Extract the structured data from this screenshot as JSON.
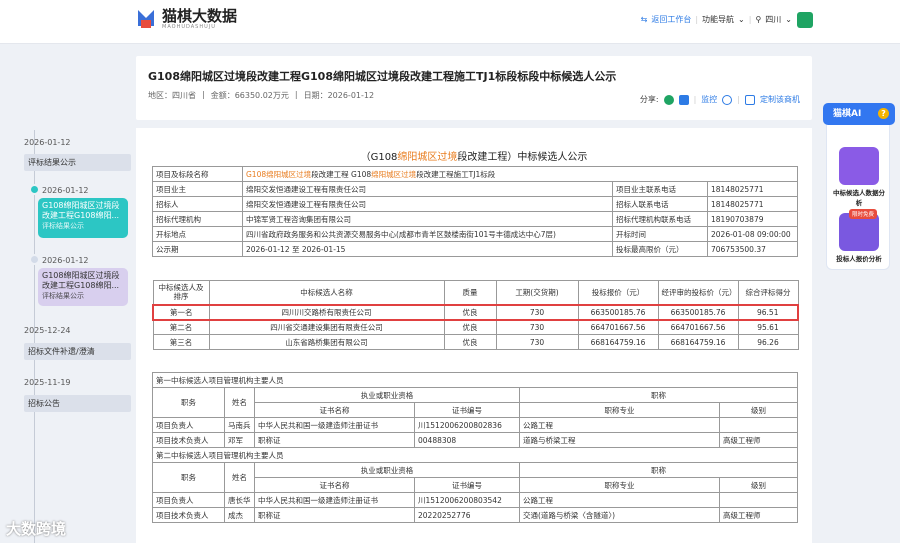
{
  "topbar": {
    "logo_text": "猫棋大数据",
    "logo_sub": "MAOHUDASHUJU",
    "back_label": "返回工作台",
    "nav_label": "功能导航",
    "region": "四川"
  },
  "header": {
    "title": "G108绵阳城区过境段改建工程G108绵阳城区过境段改建工程施工TJ1标段标段中标候选人公示",
    "region": "地区：四川省",
    "amount": "金额：66350.02万元",
    "date": "日期：2026-01-12",
    "share": "分享:",
    "monitor": "监控",
    "subscribe": "定制该商机"
  },
  "timeline": [
    {
      "date": "2026-01-12",
      "label": "评标结果公示"
    },
    {
      "date": "2026-01-12",
      "label": "G108绵阳城区过境段改建工程G108绵阳...",
      "sub": "评标结果公示"
    },
    {
      "date": "2026-01-12",
      "label": "G108绵阳城区过境段改建工程G108绵阳...",
      "sub": "评标结果公示"
    },
    {
      "date": "2025-12-24",
      "label": "招标文件补遗/澄清"
    },
    {
      "date": "2025-11-19",
      "label": "招标公告"
    }
  ],
  "doc": {
    "title_pre": "（G108",
    "title_hl": "绵阳城区过境",
    "title_post": "段改建工程）中标候选人公示"
  },
  "info": {
    "project_name_label": "项目及标段名称",
    "project_name_a": "G108绵阳城区过境",
    "project_name_b": "段改建工程 G108",
    "project_name_c": "绵阳城区过境",
    "project_name_d": "段改建工程施工TJ1标段",
    "rows": [
      [
        "项目业主",
        "绵阳交发恒通建设工程有限责任公司",
        "项目业主联系电话",
        "18148025771"
      ],
      [
        "招标人",
        "绵阳交发恒通建设工程有限责任公司",
        "招标人联系电话",
        "18148025771"
      ],
      [
        "招标代理机构",
        "中锦军贤工程咨询集团有限公司",
        "招标代理机构联系电话",
        "18190703879"
      ],
      [
        "开标地点",
        "四川省政府政务服务和公共资源交易服务中心(成都市青羊区鼓楼南街101号丰德成达中心7层)",
        "开标时间",
        "2026-01-08 09:00:00"
      ],
      [
        "公示期",
        "2026-01-12 至 2026-01-15",
        "投标最高限价（元）",
        "706753500.37"
      ]
    ]
  },
  "candidates": {
    "headers": [
      "中标候选人及排序",
      "中标候选人名称",
      "质量",
      "工期(交货期)",
      "投标报价（元）",
      "经评审的投标价（元）",
      "综合评标得分"
    ],
    "rows": [
      [
        "第一名",
        "四川川交路桥有限责任公司",
        "优良",
        "730",
        "663500185.76",
        "663500185.76",
        "96.51"
      ],
      [
        "第二名",
        "四川省交通建设集团有限责任公司",
        "优良",
        "730",
        "664701667.56",
        "664701667.56",
        "95.61"
      ],
      [
        "第三名",
        "山东省路桥集团有限公司",
        "优良",
        "730",
        "668164759.16",
        "668164759.16",
        "96.26"
      ]
    ]
  },
  "staff": {
    "sec1_title": "第一中标候选人项目管理机构主要人员",
    "sec2_title": "第二中标候选人项目管理机构主要人员",
    "h_duty": "职务",
    "h_name": "姓名",
    "h_qual": "执业或职业资格",
    "h_title": "职称",
    "h_cert": "证书名称",
    "h_certno": "证书编号",
    "h_major": "职称专业",
    "h_level": "级别",
    "sec1": [
      [
        "项目负责人",
        "马南兵",
        "中华人民共和国一级建造师注册证书",
        "川1512006200802836",
        "公路工程",
        ""
      ],
      [
        "项目技术负责人",
        "邓军",
        "职称证",
        "00488308",
        "道路与桥梁工程",
        "高级工程师"
      ]
    ],
    "sec2": [
      [
        "项目负责人",
        "唐长华",
        "中华人民共和国一级建造师注册证书",
        "川1512006200803542",
        "公路工程",
        ""
      ],
      [
        "项目技术负责人",
        "成杰",
        "职称证",
        "20220252776",
        "交通(道路与桥梁〈含隧道〉)",
        "高级工程师"
      ]
    ]
  },
  "ai": {
    "title": "猫棋AI",
    "q": "?",
    "card1": "中标候选人数据分析",
    "badge": "限时免费",
    "card2": "投标人报价分析"
  },
  "watermark": "大数跨境",
  "colors": {
    "accent": "#2d7be5",
    "highlight": "#e87c1e",
    "teal": "#2cc6c4",
    "red_box": "#e04040"
  }
}
